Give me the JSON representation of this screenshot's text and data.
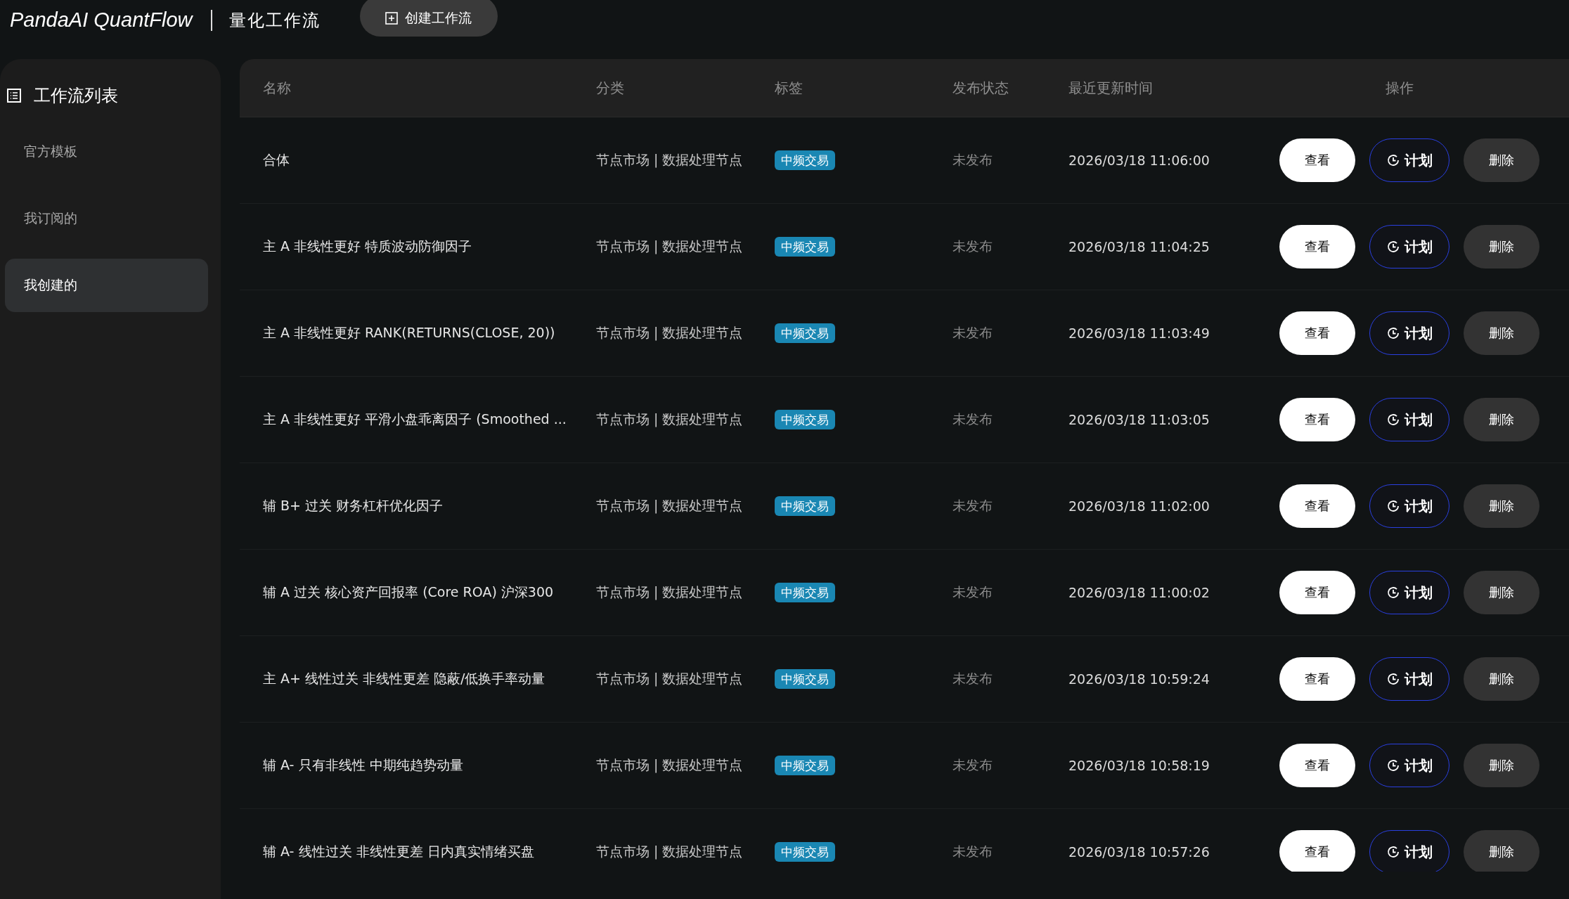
{
  "header": {
    "logo": "PandaAI QuantFlow",
    "title": "量化工作流",
    "create_button": "创建工作流"
  },
  "sidebar": {
    "title": "工作流列表",
    "items": [
      {
        "label": "官方模板",
        "selected": false
      },
      {
        "label": "我订阅的",
        "selected": false
      },
      {
        "label": "我创建的",
        "selected": true
      }
    ]
  },
  "table": {
    "columns": [
      "名称",
      "分类",
      "标签",
      "发布状态",
      "最近更新时间",
      "操作"
    ],
    "rows": [
      {
        "name": "合体",
        "category": "节点市场 | 数据处理节点",
        "tag": "中频交易",
        "status": "未发布",
        "updated": "2026/03/18 11:06:00",
        "actions": [
          {
            "kind": "view",
            "label": "查看"
          },
          {
            "kind": "schedule",
            "label": "计划"
          },
          {
            "kind": "delete",
            "label": "删除"
          }
        ]
      },
      {
        "name": "主 A 非线性更好 特质波动防御因子",
        "category": "节点市场 | 数据处理节点",
        "tag": "中频交易",
        "status": "未发布",
        "updated": "2026/03/18 11:04:25",
        "actions": [
          {
            "kind": "view",
            "label": "查看"
          },
          {
            "kind": "schedule",
            "label": "计划"
          },
          {
            "kind": "delete",
            "label": "删除"
          }
        ]
      },
      {
        "name": "主 A 非线性更好 RANK(RETURNS(CLOSE, 20))",
        "category": "节点市场 | 数据处理节点",
        "tag": "中频交易",
        "status": "未发布",
        "updated": "2026/03/18 11:03:49",
        "actions": [
          {
            "kind": "view",
            "label": "查看"
          },
          {
            "kind": "schedule",
            "label": "计划"
          },
          {
            "kind": "delete",
            "label": "删除"
          }
        ]
      },
      {
        "name": "主 A 非线性更好 平滑小盘乖离因子 (Smoothed ...",
        "category": "节点市场 | 数据处理节点",
        "tag": "中频交易",
        "status": "未发布",
        "updated": "2026/03/18 11:03:05",
        "actions": [
          {
            "kind": "view",
            "label": "查看"
          },
          {
            "kind": "schedule",
            "label": "计划"
          },
          {
            "kind": "delete",
            "label": "删除"
          }
        ]
      },
      {
        "name": "辅 B+ 过关 财务杠杆优化因子",
        "category": "节点市场 | 数据处理节点",
        "tag": "中频交易",
        "status": "未发布",
        "updated": "2026/03/18 11:02:00",
        "actions": [
          {
            "kind": "view",
            "label": "查看"
          },
          {
            "kind": "schedule",
            "label": "计划"
          },
          {
            "kind": "delete",
            "label": "删除"
          }
        ]
      },
      {
        "name": "辅 A 过关 核心资产回报率 (Core ROA) 沪深300",
        "category": "节点市场 | 数据处理节点",
        "tag": "中频交易",
        "status": "未发布",
        "updated": "2026/03/18 11:00:02",
        "actions": [
          {
            "kind": "view",
            "label": "查看"
          },
          {
            "kind": "schedule",
            "label": "计划"
          },
          {
            "kind": "delete",
            "label": "删除"
          }
        ]
      },
      {
        "name": "主 A+ 线性过关 非线性更差 隐蔽/低换手率动量",
        "category": "节点市场 | 数据处理节点",
        "tag": "中频交易",
        "status": "未发布",
        "updated": "2026/03/18 10:59:24",
        "actions": [
          {
            "kind": "view",
            "label": "查看"
          },
          {
            "kind": "schedule",
            "label": "计划"
          },
          {
            "kind": "delete",
            "label": "删除"
          }
        ]
      },
      {
        "name": "辅 A- 只有非线性 中期纯趋势动量",
        "category": "节点市场 | 数据处理节点",
        "tag": "中频交易",
        "status": "未发布",
        "updated": "2026/03/18 10:58:19",
        "actions": [
          {
            "kind": "view",
            "label": "查看"
          },
          {
            "kind": "schedule",
            "label": "计划"
          },
          {
            "kind": "delete",
            "label": "删除"
          }
        ]
      },
      {
        "name": "辅 A- 线性过关 非线性更差 日内真实情绪买盘",
        "category": "节点市场 | 数据处理节点",
        "tag": "中频交易",
        "status": "未发布",
        "updated": "2026/03/18 10:57:26",
        "actions": [
          {
            "kind": "view",
            "label": "查看"
          },
          {
            "kind": "schedule",
            "label": "计划"
          },
          {
            "kind": "delete",
            "label": "删除"
          }
        ]
      }
    ]
  }
}
